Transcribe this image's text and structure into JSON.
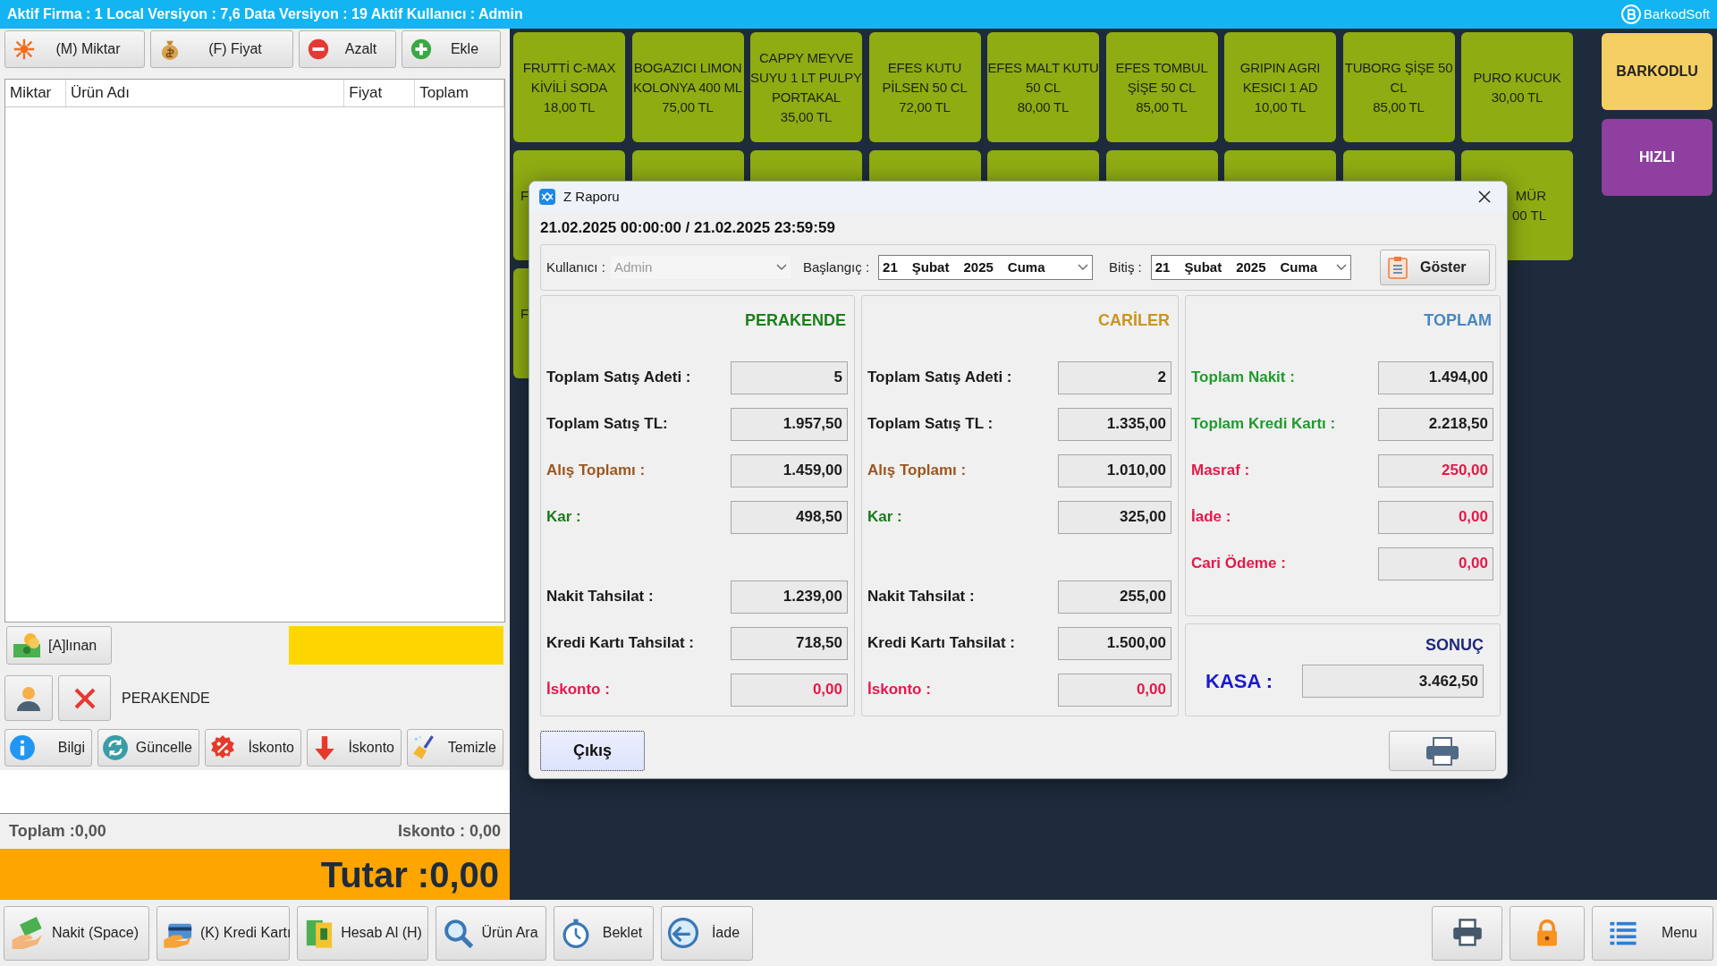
{
  "header_bar": {
    "title": "Aktif Firma : 1 Local Versiyon : 7,6 Data Versiyon : 19 Aktif Kullanıcı : Admin",
    "brand": "BarkodSoft"
  },
  "toolbar": [
    {
      "label": "(M) Miktar",
      "kind": "burst"
    },
    {
      "label": "(F) Fiyat",
      "kind": "moneybag"
    },
    {
      "label": "Azalt",
      "kind": "minus"
    },
    {
      "label": "Ekle",
      "kind": "plus"
    }
  ],
  "cart_table": {
    "columns": [
      "Miktar",
      "Ürün Adı",
      "Fiyat",
      "Toplam"
    ]
  },
  "received_button": {
    "label": "[A]lınan"
  },
  "customer": {
    "name": "PERAKENDE"
  },
  "action_buttons": [
    {
      "label": "Bilgi",
      "kind": "info"
    },
    {
      "label": "Güncelle",
      "kind": "refresh"
    },
    {
      "label": "İskonto",
      "kind": "percent"
    },
    {
      "label": "İskonto",
      "kind": "down"
    },
    {
      "label": "Temizle",
      "kind": "broom"
    }
  ],
  "totals": {
    "total": "Toplam :0,00",
    "discount": "Iskonto : 0,00"
  },
  "amount": "Tutar :0,00",
  "bottom_buttons": [
    {
      "label": "Nakit (Space)",
      "kind": "cash-hand"
    },
    {
      "label": "(K) Kredi Kartı",
      "kind": "card"
    },
    {
      "label": "Hesab Al (H)",
      "kind": "bill"
    },
    {
      "label": "Ürün Ara",
      "kind": "search"
    },
    {
      "label": "Beklet",
      "kind": "stopwatch"
    },
    {
      "label": "İade",
      "kind": "return"
    }
  ],
  "right_buttons": [
    {
      "kind": "printer"
    },
    {
      "kind": "lock"
    },
    {
      "kind": "menu",
      "label": "Menu"
    }
  ],
  "products": [
    {
      "kind": "full",
      "lines": [
        "FRUTTİ C-MAX KİVİLİ SODA",
        "18,00 TL"
      ]
    },
    {
      "kind": "full",
      "lines": [
        "BOGAZICI LIMON KOLONYA 400 ML",
        "75,00 TL"
      ]
    },
    {
      "kind": "full",
      "lines": [
        "CAPPY MEYVE SUYU 1 LT PULPY PORTAKAL",
        "35,00 TL"
      ]
    },
    {
      "kind": "full",
      "lines": [
        "EFES KUTU PİLSEN 50 CL",
        "72,00 TL"
      ]
    },
    {
      "kind": "full",
      "lines": [
        "EFES MALT KUTU 50 CL",
        "80,00 TL"
      ]
    },
    {
      "kind": "full",
      "lines": [
        "EFES TOMBUL ŞİŞE 50 CL",
        "85,00 TL"
      ]
    },
    {
      "kind": "full",
      "lines": [
        "GRIPIN AGRI KESICI 1 AD",
        "10,00 TL"
      ]
    },
    {
      "kind": "full",
      "lines": [
        "TUBORG ŞİŞE 50 CL",
        "85,00 TL"
      ]
    },
    {
      "kind": "full",
      "lines": [
        "PURO KUCUK",
        "30,00 TL"
      ]
    },
    {
      "kind": "edge-left",
      "lines": [
        "F"
      ]
    },
    {
      "kind": "blank"
    },
    {
      "kind": "blank"
    },
    {
      "kind": "blank"
    },
    {
      "kind": "blank"
    },
    {
      "kind": "blank"
    },
    {
      "kind": "blank"
    },
    {
      "kind": "blank"
    },
    {
      "kind": "edge-right",
      "lines": [
        "MÜR",
        "00 TL"
      ]
    },
    {
      "kind": "edge-left",
      "lines": [
        "F"
      ]
    }
  ],
  "categories": [
    {
      "label": "BARKODLU",
      "color": "#f4cf63"
    },
    {
      "label": "HIZLI",
      "color": "#8e3f9f"
    }
  ],
  "dialog": {
    "title": "Z Raporu",
    "range": "21.02.2025 00:00:00 / 21.02.2025 23:59:59",
    "user": {
      "label": "Kullanıcı :",
      "value": "Admin",
      "disabled": true
    },
    "start": {
      "label": "Başlangıç :",
      "day": "21",
      "month": "Şubat",
      "year": "2025",
      "weekday": "Cuma"
    },
    "end": {
      "label": "Bitiş :",
      "day": "21",
      "month": "Şubat",
      "year": "2025",
      "weekday": "Cuma"
    },
    "show_button": "Göster",
    "panels": [
      {
        "title": "PERAKENDE",
        "color": "#1a7f1a",
        "rows": [
          {
            "label": "Toplam Satış Adeti :",
            "value": "5",
            "color": "#1a1a1a",
            "value_colored": false
          },
          {
            "label": "Toplam Satış TL:",
            "value": "1.957,50",
            "color": "#1a1a1a",
            "value_colored": false
          },
          {
            "label": "Alış Toplamı :",
            "value": "1.459,00",
            "color": "#9c561e",
            "value_colored": false
          },
          {
            "label": "Kar :",
            "value": "498,50",
            "color": "#1a7a1a",
            "value_colored": false
          }
        ],
        "lower_rows": [
          {
            "label": "Nakit  Tahsilat :",
            "value": "1.239,00",
            "color": "#1a1a1a",
            "value_colored": false
          },
          {
            "label": "Kredi Kartı Tahsilat :",
            "value": "718,50",
            "color": "#1a1a1a",
            "value_colored": false
          },
          {
            "label": "İskonto :",
            "value": "0,00",
            "color": "#e5194a",
            "value_colored": true
          }
        ]
      },
      {
        "title": "CARİLER",
        "color": "#c9951f",
        "rows": [
          {
            "label": "Toplam Satış Adeti :",
            "value": "2",
            "color": "#1a1a1a",
            "value_colored": false
          },
          {
            "label": "Toplam Satış TL :",
            "value": "1.335,00",
            "color": "#1a1a1a",
            "value_colored": false
          },
          {
            "label": "Alış Toplamı :",
            "value": "1.010,00",
            "color": "#9c561e",
            "value_colored": false
          },
          {
            "label": "Kar :",
            "value": "325,00",
            "color": "#1a7a1a",
            "value_colored": false
          }
        ],
        "lower_rows": [
          {
            "label": "Nakit  Tahsilat :",
            "value": "255,00",
            "color": "#1a1a1a",
            "value_colored": false
          },
          {
            "label": "Kredi Kartı Tahsilat :",
            "value": "1.500,00",
            "color": "#1a1a1a",
            "value_colored": false
          },
          {
            "label": "İskonto :",
            "value": "0,00",
            "color": "#e5194a",
            "value_colored": true
          }
        ]
      },
      {
        "title": "TOPLAM",
        "color": "#4a86c0",
        "rows": [
          {
            "label": "Toplam Nakit :",
            "value": "1.494,00",
            "color": "#1f9b2d",
            "value_colored": false
          },
          {
            "label": "Toplam Kredi Kartı :",
            "value": "2.218,50",
            "color": "#1f9b2d",
            "value_colored": false
          },
          {
            "label": "Masraf :",
            "value": "250,00",
            "color": "#e5194a",
            "value_colored": true
          },
          {
            "label": "İade :",
            "value": "0,00",
            "color": "#e5194a",
            "value_colored": true
          },
          {
            "label": "Cari Ödeme :",
            "value": "0,00",
            "color": "#e5194a",
            "value_colored": true
          }
        ]
      }
    ],
    "result": {
      "title": "SONUÇ",
      "label": "KASA :",
      "value": "3.462,50"
    },
    "exit_button": "Çıkış"
  }
}
